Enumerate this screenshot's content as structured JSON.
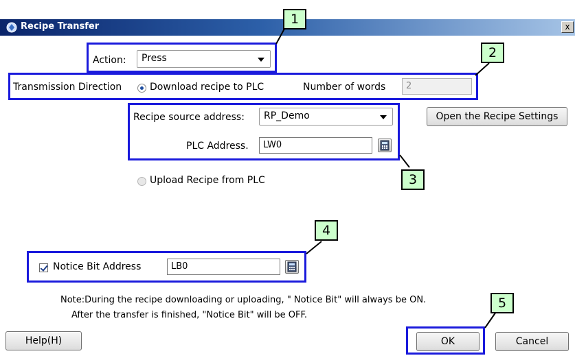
{
  "window": {
    "title": "Recipe Transfer",
    "close_label": "x"
  },
  "action": {
    "label": "Action:",
    "value": "Press"
  },
  "transmission": {
    "label": "Transmission Direction",
    "download_option": "Download recipe to PLC",
    "download_selected": true,
    "words_label": "Number of words",
    "words_value": "2",
    "upload_option": "Upload Recipe from PLC"
  },
  "recipe": {
    "source_label": "Recipe source address:",
    "source_value": "RP_Demo",
    "plc_label": "PLC Address.",
    "plc_value": "LW0",
    "open_settings_label": "Open the Recipe Settings"
  },
  "notice": {
    "checkbox_label": "Notice Bit Address",
    "checked": true,
    "address_value": "LB0",
    "note_line1": "Note:During the recipe downloading or uploading, \" Notice Bit\" will always be ON.",
    "note_line2": "After the transfer is finished, \"Notice Bit\" will be OFF."
  },
  "buttons": {
    "help": "Help(H)",
    "ok": "OK",
    "cancel": "Cancel"
  },
  "callouts": [
    "1",
    "2",
    "3",
    "4",
    "5"
  ],
  "colors": {
    "highlight": "#1a1adc",
    "callout_fill": "#ccffcc"
  }
}
